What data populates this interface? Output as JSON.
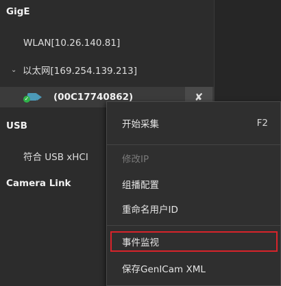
{
  "tree": {
    "gige": {
      "label": "GigE"
    },
    "wlan": {
      "label": "WLAN[10.26.140.81]"
    },
    "ethernet": {
      "label": "以太网[169.254.139.213]"
    },
    "camera": {
      "label": "(00C17740862)",
      "status_icon": "check-icon",
      "action_icon": "disconnect-icon"
    },
    "usb": {
      "label": "USB"
    },
    "usb_item": {
      "label": "符合 USB xHCI"
    },
    "camera_link": {
      "label": "Camera Link"
    }
  },
  "context_menu": {
    "items": [
      {
        "label": "开始采集",
        "shortcut": "F2",
        "disabled": false
      },
      {
        "label": "修改IP",
        "disabled": true
      },
      {
        "label": "组播配置",
        "disabled": false
      },
      {
        "label": "重命名用户ID",
        "disabled": false
      },
      {
        "label": "事件监视",
        "disabled": false,
        "highlighted": true
      },
      {
        "label": "保存GenICam XML",
        "disabled": false
      }
    ]
  },
  "colors": {
    "highlight_border": "#d9232a",
    "camera_icon": "#4c9ab8",
    "status_ok": "#2fb24a"
  }
}
